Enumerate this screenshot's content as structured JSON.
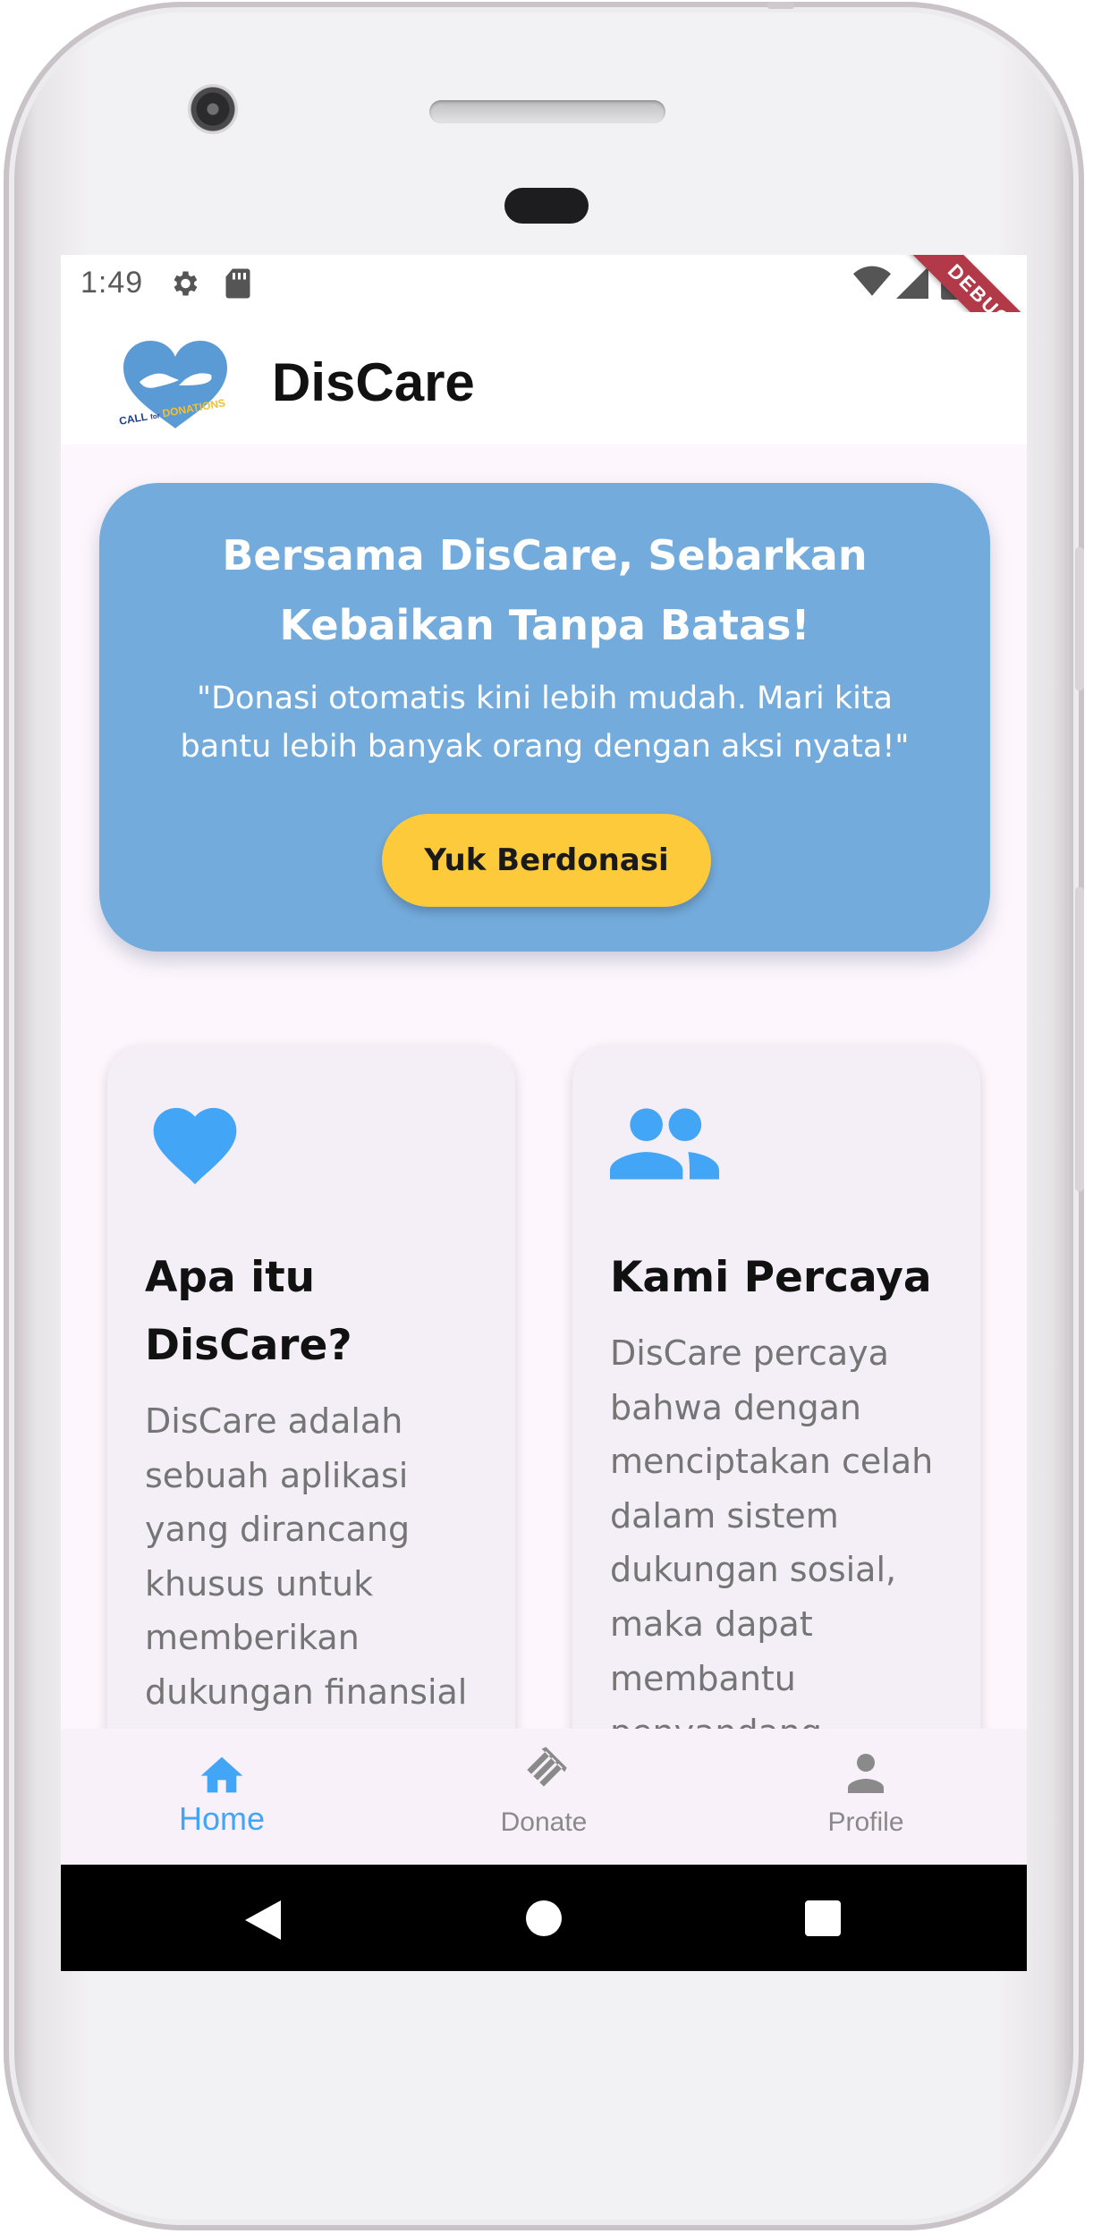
{
  "status_bar": {
    "time": "1:49",
    "left_icons": [
      "gear-icon",
      "sd-card-icon"
    ],
    "right_icons": [
      "wifi-icon",
      "cellular-signal-icon",
      "battery-icon"
    ],
    "debug_banner": "DEBUG"
  },
  "app_bar": {
    "logo_text": "CALL for DONATIONS",
    "title": "DisCare"
  },
  "hero": {
    "title": "Bersama DisCare, Sebarkan Kebaikan Tanpa Batas!",
    "subtitle": "\"Donasi otomatis kini lebih mudah. Mari kita bantu lebih banyak orang dengan aksi nyata!\"",
    "button_label": "Yuk Berdonasi"
  },
  "cards": [
    {
      "icon": "heart-icon",
      "title": "Apa itu DisCare?",
      "body": "DisCare adalah sebuah aplikasi yang dirancang khusus untuk memberikan dukungan finansial kepada"
    },
    {
      "icon": "people-icon",
      "title": "Kami Percaya",
      "body": "DisCare percaya bahwa dengan menciptakan celah dalam sistem dukungan sosial, maka dapat membantu penyandang"
    }
  ],
  "bottom_nav": {
    "items": [
      {
        "label": "Home",
        "icon": "home-icon",
        "selected": true
      },
      {
        "label": "Donate",
        "icon": "handshake-icon",
        "selected": false
      },
      {
        "label": "Profile",
        "icon": "person-icon",
        "selected": false
      }
    ]
  },
  "system_nav": {
    "buttons": [
      "back-triangle-icon",
      "home-circle-icon",
      "recents-square-icon"
    ]
  },
  "colors": {
    "hero_bg": "#73abdc",
    "button_yellow": "#fdca3c",
    "accent_blue": "#42a5f5",
    "inactive_grey": "#8a8a8a",
    "debug_red": "#b23a48"
  }
}
